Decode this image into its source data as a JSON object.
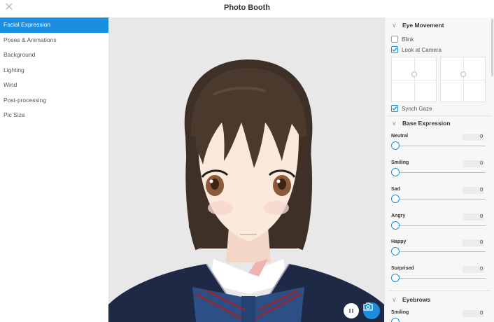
{
  "window": {
    "title": "Photo Booth"
  },
  "menu": {
    "items": [
      {
        "label": "Facial Expression"
      },
      {
        "label": "Poses & Animations"
      },
      {
        "label": "Background"
      },
      {
        "label": "Lighting"
      },
      {
        "label": "Wind"
      },
      {
        "label": "Post-processing"
      },
      {
        "label": "Pic Size"
      }
    ],
    "active_index": 0
  },
  "panel": {
    "eye_movement": {
      "title": "Eye Movement",
      "blink": {
        "label": "Blink",
        "checked": false
      },
      "look_at_camera": {
        "label": "Look at Camera",
        "checked": true
      },
      "synch_gaze": {
        "label": "Synch Gaze",
        "checked": true
      }
    },
    "base_expression": {
      "title": "Base Expression",
      "sliders": [
        {
          "label": "Neutral",
          "value": "0"
        },
        {
          "label": "Smiling",
          "value": "0"
        },
        {
          "label": "Sad",
          "value": "0"
        },
        {
          "label": "Angry",
          "value": "0"
        },
        {
          "label": "Happy",
          "value": "0"
        },
        {
          "label": "Surprised",
          "value": "0"
        }
      ]
    },
    "eyebrows": {
      "title": "Eyebrows",
      "sliders": [
        {
          "label": "Smiling",
          "value": "0"
        }
      ]
    }
  },
  "colors": {
    "accent": "#1a8fe0",
    "hair": "#4a3a2e",
    "skin": "#fbe9dc",
    "jacket": "#1e2a45"
  },
  "icons": {
    "close": "close-icon",
    "chevron": "chevron-down-icon",
    "check": "checkmark-icon",
    "pause": "pause-icon",
    "camera": "camera-icon"
  }
}
